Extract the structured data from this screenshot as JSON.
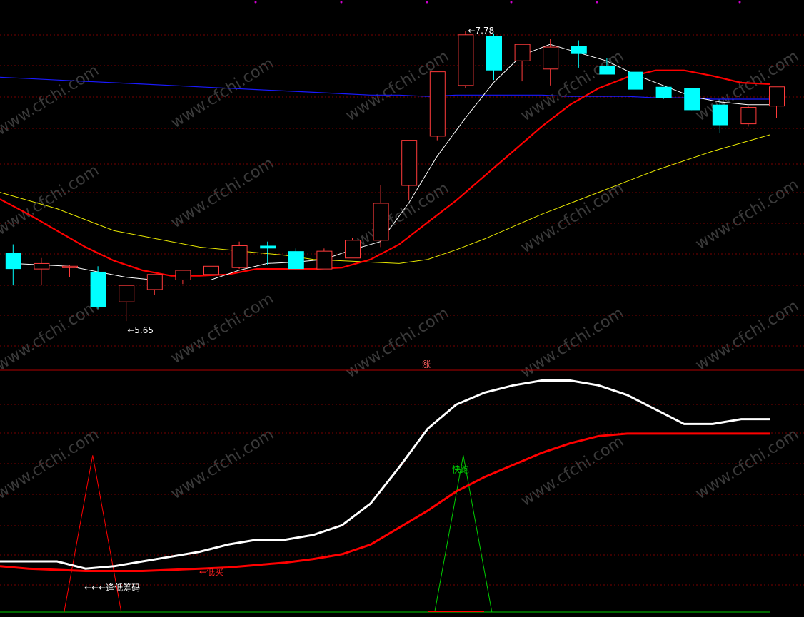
{
  "colors": {
    "background": "#000000",
    "grid": "#7a0000",
    "up": "#ff3b3b",
    "down": "#00ffff",
    "ma_white": "#ffffff",
    "ma_red": "#ff0000",
    "ma_yellow": "#e6e600",
    "ma_blue": "#1a1aff",
    "signal_red": "#ff0000",
    "signal_green": "#00cc00",
    "watermark": "#3a3a3a"
  },
  "watermark": "www.cfchi.com",
  "price_annotations": {
    "high_label": "7.78",
    "low_label": "5.65"
  },
  "middle_marker": "涨",
  "indicator_labels": {
    "fast_run": "快跑",
    "buy_low": "低买",
    "low_chips": "逢低筹码"
  },
  "chart_data": [
    {
      "type": "candlestick",
      "title": "",
      "ylim": [
        5.4,
        7.9
      ],
      "candles": [
        {
          "o": 6.16,
          "h": 6.22,
          "l": 5.92,
          "c": 6.04
        },
        {
          "o": 6.04,
          "h": 6.12,
          "l": 5.92,
          "c": 6.08
        },
        {
          "o": 6.06,
          "h": 6.07,
          "l": 5.98,
          "c": 6.06
        },
        {
          "o": 6.02,
          "h": 6.06,
          "l": 5.75,
          "c": 5.76
        },
        {
          "o": 5.8,
          "h": 5.92,
          "l": 5.66,
          "c": 5.92
        },
        {
          "o": 5.89,
          "h": 6.0,
          "l": 5.85,
          "c": 6.0
        },
        {
          "o": 5.96,
          "h": 6.03,
          "l": 5.93,
          "c": 6.03
        },
        {
          "o": 6.0,
          "h": 6.1,
          "l": 5.98,
          "c": 6.06
        },
        {
          "o": 6.05,
          "h": 6.24,
          "l": 6.04,
          "c": 6.21
        },
        {
          "o": 6.21,
          "h": 6.24,
          "l": 6.07,
          "c": 6.19
        },
        {
          "o": 6.17,
          "h": 6.19,
          "l": 6.04,
          "c": 6.04
        },
        {
          "o": 6.04,
          "h": 6.19,
          "l": 6.04,
          "c": 6.17
        },
        {
          "o": 6.12,
          "h": 6.27,
          "l": 6.12,
          "c": 6.25
        },
        {
          "o": 6.25,
          "h": 6.65,
          "l": 6.2,
          "c": 6.52
        },
        {
          "o": 6.65,
          "h": 6.86,
          "l": 6.54,
          "c": 6.98
        },
        {
          "o": 7.01,
          "h": 7.48,
          "l": 6.98,
          "c": 7.48
        },
        {
          "o": 7.38,
          "h": 7.78,
          "l": 7.36,
          "c": 7.75
        },
        {
          "o": 7.74,
          "h": 7.76,
          "l": 7.42,
          "c": 7.49
        },
        {
          "o": 7.56,
          "h": 7.68,
          "l": 7.41,
          "c": 7.68
        },
        {
          "o": 7.5,
          "h": 7.72,
          "l": 7.38,
          "c": 7.66
        },
        {
          "o": 7.67,
          "h": 7.71,
          "l": 7.51,
          "c": 7.61
        },
        {
          "o": 7.52,
          "h": 7.58,
          "l": 7.46,
          "c": 7.46
        },
        {
          "o": 7.48,
          "h": 7.56,
          "l": 7.35,
          "c": 7.35
        },
        {
          "o": 7.37,
          "h": 7.36,
          "l": 7.28,
          "c": 7.29
        },
        {
          "o": 7.36,
          "h": 7.28,
          "l": 7.28,
          "c": 7.2
        },
        {
          "o": 7.24,
          "h": 7.28,
          "l": 7.03,
          "c": 7.09
        },
        {
          "o": 7.1,
          "h": 7.23,
          "l": 7.08,
          "c": 7.22
        },
        {
          "o": 7.23,
          "h": 7.36,
          "l": 7.14,
          "c": 7.37
        }
      ],
      "ma_white": [
        6.08,
        6.07,
        6.06,
        6.02,
        5.98,
        5.96,
        5.96,
        5.96,
        6.03,
        6.08,
        6.09,
        6.11,
        6.18,
        6.24,
        6.52,
        6.86,
        7.14,
        7.4,
        7.6,
        7.68,
        7.62,
        7.56,
        7.46,
        7.38,
        7.3,
        7.26,
        7.24,
        7.24
      ],
      "ma_red": [
        6.55,
        6.44,
        6.32,
        6.2,
        6.1,
        6.03,
        5.99,
        5.99,
        6.0,
        6.04,
        6.04,
        6.04,
        6.05,
        6.11,
        6.22,
        6.38,
        6.54,
        6.72,
        6.9,
        7.08,
        7.24,
        7.36,
        7.44,
        7.49,
        7.49,
        7.45,
        7.4,
        7.39
      ],
      "ma_yellow": [
        6.6,
        6.54,
        6.48,
        6.4,
        6.32,
        6.28,
        6.24,
        6.2,
        6.18,
        6.16,
        6.14,
        6.11,
        6.1,
        6.09,
        6.08,
        6.11,
        6.18,
        6.26,
        6.35,
        6.44,
        6.52,
        6.6,
        6.68,
        6.76,
        6.83,
        6.9,
        6.96,
        7.02
      ],
      "ma_blue": [
        7.44,
        7.43,
        7.42,
        7.41,
        7.4,
        7.39,
        7.38,
        7.37,
        7.36,
        7.35,
        7.34,
        7.33,
        7.32,
        7.31,
        7.31,
        7.3,
        7.31,
        7.31,
        7.31,
        7.31,
        7.3,
        7.3,
        7.3,
        7.29,
        7.29,
        7.28,
        7.28,
        7.28
      ]
    },
    {
      "type": "line",
      "title": "",
      "ylim": [
        0,
        100
      ],
      "series": [
        {
          "key": "white",
          "values": [
            21,
            21,
            21,
            18,
            19,
            21,
            23,
            25,
            28,
            30,
            30,
            32,
            36,
            45,
            60,
            76,
            86,
            91,
            94,
            96,
            96,
            94,
            90,
            84,
            78,
            78,
            80,
            80
          ]
        },
        {
          "key": "red",
          "values": [
            19,
            18,
            17.5,
            17,
            17,
            17,
            17.5,
            18,
            18.5,
            19.5,
            20.5,
            22,
            24,
            28,
            35,
            42,
            50,
            56,
            61,
            66,
            70,
            73,
            74,
            74,
            74,
            74,
            74,
            74
          ]
        }
      ],
      "spikes": [
        {
          "color": "red",
          "index": 3,
          "peak": 65,
          "label_key": ""
        },
        {
          "color": "green",
          "index": 16,
          "peak": 65,
          "label_key": "fast_run"
        }
      ]
    }
  ]
}
